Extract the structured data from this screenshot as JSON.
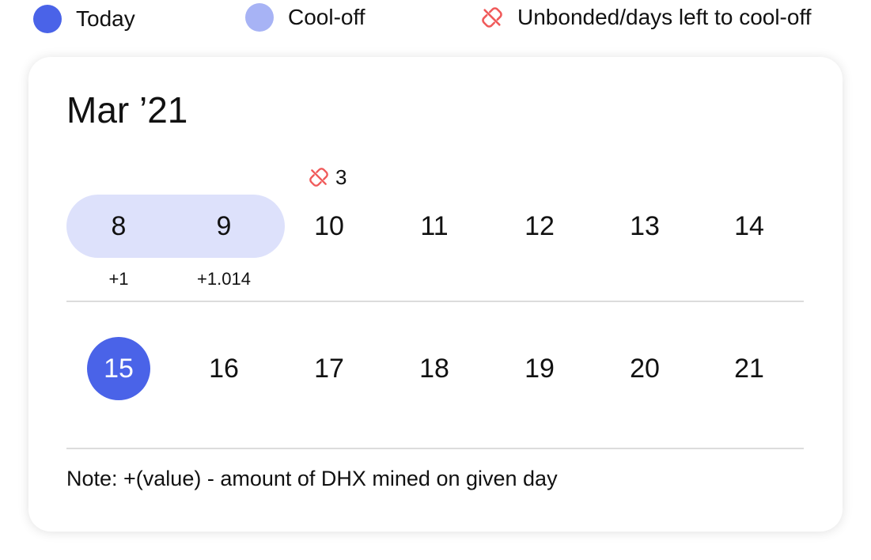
{
  "colors": {
    "today": "#4a63e8",
    "cooloff": "#a7b3f5",
    "cooloff_range": "#dde1fb",
    "unbonded": "#f05a5a"
  },
  "legend": [
    {
      "label": "Today",
      "icon": "dot-icon",
      "color": "#4a63e8"
    },
    {
      "label": "Cool-off",
      "icon": "dot-icon",
      "color": "#a7b3f5"
    },
    {
      "label": "Unbonded/days left to cool-off",
      "icon": "broken-link-icon",
      "color": "#f05a5a"
    }
  ],
  "calendar": {
    "month_title": "Mar ’21",
    "weeks": [
      {
        "days": [
          {
            "number": "8",
            "mined": "+1",
            "cooloff": true
          },
          {
            "number": "9",
            "mined": "+1.014",
            "cooloff": true
          },
          {
            "number": "10",
            "unbonded_days_left": "3"
          },
          {
            "number": "11"
          },
          {
            "number": "12"
          },
          {
            "number": "13"
          },
          {
            "number": "14"
          }
        ]
      },
      {
        "days": [
          {
            "number": "15",
            "today": true
          },
          {
            "number": "16"
          },
          {
            "number": "17"
          },
          {
            "number": "18"
          },
          {
            "number": "19"
          },
          {
            "number": "20"
          },
          {
            "number": "21"
          }
        ]
      }
    ],
    "note": "Note: +(value) - amount of DHX mined on given day"
  }
}
